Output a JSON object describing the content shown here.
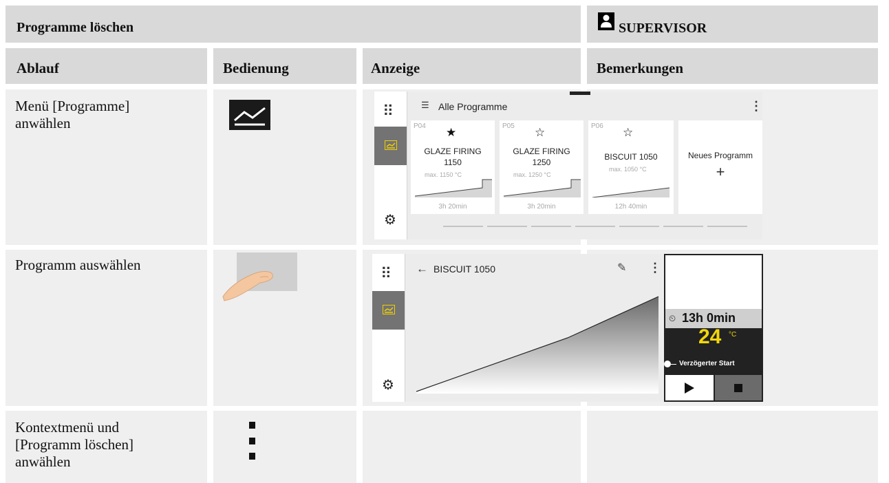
{
  "header": {
    "title": "Programme löschen",
    "role": "SUPERVISOR"
  },
  "columns": [
    "Ablauf",
    "Bedienung",
    "Anzeige",
    "Bemerkungen"
  ],
  "rows": [
    {
      "step": "Menü [Programme] anwählen"
    },
    {
      "step": "Programm auswählen"
    },
    {
      "step": "Kontextmenü und [Programm löschen] anwählen"
    }
  ],
  "screen1": {
    "title": "Alle Programme",
    "cards": [
      {
        "code": "P04",
        "name1": "GLAZE FIRING",
        "name2": "1150",
        "max": "max. 1150 °C",
        "duration": "3h 20min",
        "favorite": true
      },
      {
        "code": "P05",
        "name1": "GLAZE FIRING",
        "name2": "1250",
        "max": "max. 1250 °C",
        "duration": "3h 20min",
        "favorite": false
      },
      {
        "code": "P06",
        "name1": "BISCUIT 1050",
        "name2": "",
        "max": "max. 1050 °C",
        "duration": "12h 40min",
        "favorite": false
      }
    ],
    "new_program": "Neues Programm",
    "plus": "+"
  },
  "screen2": {
    "title": "BISCUIT 1050",
    "time": "13h 0min",
    "temp": "24",
    "temp_unit": "°C",
    "delayed_start": "Verzögerter Start"
  },
  "icons": {
    "grid": "⠿",
    "list": "☰",
    "more": "⋮",
    "back": "←",
    "edit": "✎",
    "gear": "⚙",
    "clock": "🕒"
  }
}
